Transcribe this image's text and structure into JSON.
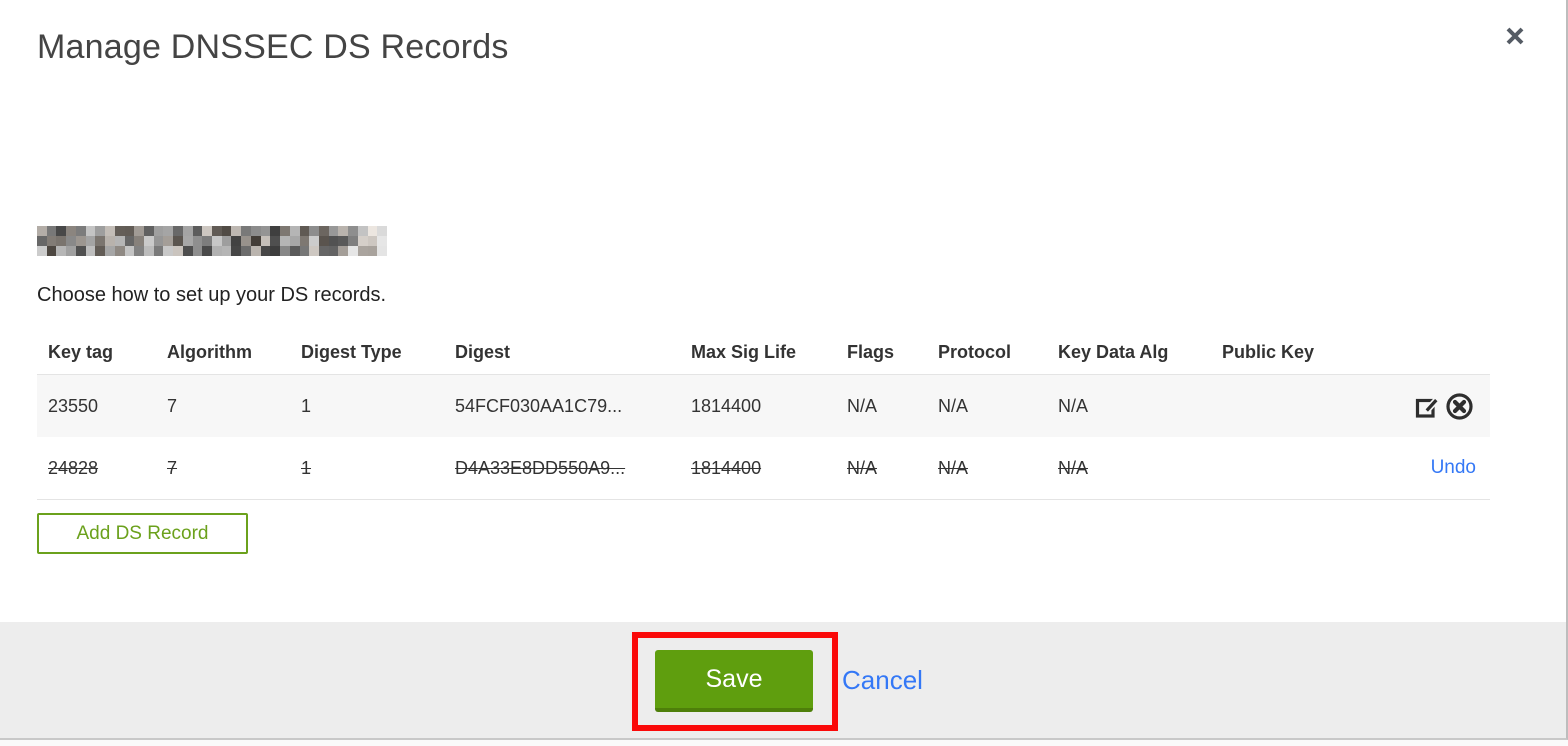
{
  "modal": {
    "title": "Manage DNSSEC DS Records",
    "intro": "Choose how to set up your DS records.",
    "close_icon_glyph": "✕",
    "table": {
      "headers": [
        "Key tag",
        "Algorithm",
        "Digest Type",
        "Digest",
        "Max Sig Life",
        "Flags",
        "Protocol",
        "Key Data Alg",
        "Public Key"
      ],
      "rows": [
        {
          "key_tag": "23550",
          "algorithm": "7",
          "digest_type": "1",
          "digest": "54FCF030AA1C79...",
          "max_sig_life": "1814400",
          "flags": "N/A",
          "protocol": "N/A",
          "key_data_alg": "N/A",
          "public_key": "",
          "state": "normal"
        },
        {
          "key_tag": "24828",
          "algorithm": "7",
          "digest_type": "1",
          "digest": "D4A33E8DD550A9...",
          "max_sig_life": "1814400",
          "flags": "N/A",
          "protocol": "N/A",
          "key_data_alg": "N/A",
          "public_key": "",
          "state": "deleted",
          "undo_label": "Undo"
        }
      ]
    },
    "add_button_label": "Add DS Record",
    "footer": {
      "save_label": "Save",
      "cancel_label": "Cancel"
    },
    "colors": {
      "green": "#6ba11c",
      "green_btn": "#5f9e0e",
      "green_dark": "#4e7f0a",
      "link_blue": "#3478f6",
      "annotation_red": "#fa0909",
      "footer_bg": "#ededed",
      "row_alt_bg": "#f7f7f7"
    }
  }
}
